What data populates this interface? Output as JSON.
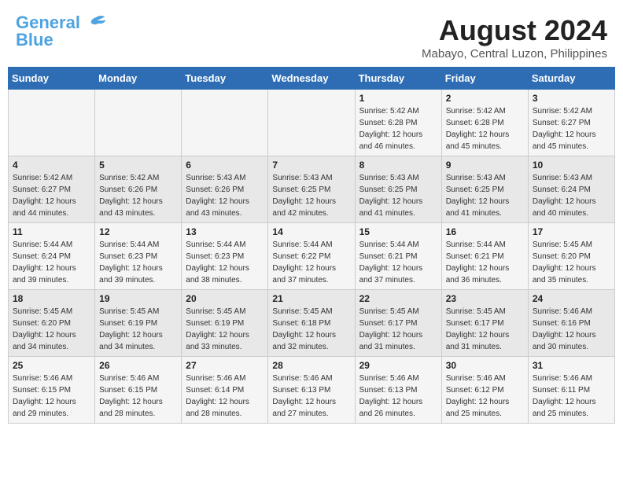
{
  "header": {
    "logo_line1": "General",
    "logo_line2": "Blue",
    "month_year": "August 2024",
    "location": "Mabayo, Central Luzon, Philippines"
  },
  "days_of_week": [
    "Sunday",
    "Monday",
    "Tuesday",
    "Wednesday",
    "Thursday",
    "Friday",
    "Saturday"
  ],
  "weeks": [
    [
      {
        "day": "",
        "info": ""
      },
      {
        "day": "",
        "info": ""
      },
      {
        "day": "",
        "info": ""
      },
      {
        "day": "",
        "info": ""
      },
      {
        "day": "1",
        "info": "Sunrise: 5:42 AM\nSunset: 6:28 PM\nDaylight: 12 hours\nand 46 minutes."
      },
      {
        "day": "2",
        "info": "Sunrise: 5:42 AM\nSunset: 6:28 PM\nDaylight: 12 hours\nand 45 minutes."
      },
      {
        "day": "3",
        "info": "Sunrise: 5:42 AM\nSunset: 6:27 PM\nDaylight: 12 hours\nand 45 minutes."
      }
    ],
    [
      {
        "day": "4",
        "info": "Sunrise: 5:42 AM\nSunset: 6:27 PM\nDaylight: 12 hours\nand 44 minutes."
      },
      {
        "day": "5",
        "info": "Sunrise: 5:42 AM\nSunset: 6:26 PM\nDaylight: 12 hours\nand 43 minutes."
      },
      {
        "day": "6",
        "info": "Sunrise: 5:43 AM\nSunset: 6:26 PM\nDaylight: 12 hours\nand 43 minutes."
      },
      {
        "day": "7",
        "info": "Sunrise: 5:43 AM\nSunset: 6:25 PM\nDaylight: 12 hours\nand 42 minutes."
      },
      {
        "day": "8",
        "info": "Sunrise: 5:43 AM\nSunset: 6:25 PM\nDaylight: 12 hours\nand 41 minutes."
      },
      {
        "day": "9",
        "info": "Sunrise: 5:43 AM\nSunset: 6:25 PM\nDaylight: 12 hours\nand 41 minutes."
      },
      {
        "day": "10",
        "info": "Sunrise: 5:43 AM\nSunset: 6:24 PM\nDaylight: 12 hours\nand 40 minutes."
      }
    ],
    [
      {
        "day": "11",
        "info": "Sunrise: 5:44 AM\nSunset: 6:24 PM\nDaylight: 12 hours\nand 39 minutes."
      },
      {
        "day": "12",
        "info": "Sunrise: 5:44 AM\nSunset: 6:23 PM\nDaylight: 12 hours\nand 39 minutes."
      },
      {
        "day": "13",
        "info": "Sunrise: 5:44 AM\nSunset: 6:23 PM\nDaylight: 12 hours\nand 38 minutes."
      },
      {
        "day": "14",
        "info": "Sunrise: 5:44 AM\nSunset: 6:22 PM\nDaylight: 12 hours\nand 37 minutes."
      },
      {
        "day": "15",
        "info": "Sunrise: 5:44 AM\nSunset: 6:21 PM\nDaylight: 12 hours\nand 37 minutes."
      },
      {
        "day": "16",
        "info": "Sunrise: 5:44 AM\nSunset: 6:21 PM\nDaylight: 12 hours\nand 36 minutes."
      },
      {
        "day": "17",
        "info": "Sunrise: 5:45 AM\nSunset: 6:20 PM\nDaylight: 12 hours\nand 35 minutes."
      }
    ],
    [
      {
        "day": "18",
        "info": "Sunrise: 5:45 AM\nSunset: 6:20 PM\nDaylight: 12 hours\nand 34 minutes."
      },
      {
        "day": "19",
        "info": "Sunrise: 5:45 AM\nSunset: 6:19 PM\nDaylight: 12 hours\nand 34 minutes."
      },
      {
        "day": "20",
        "info": "Sunrise: 5:45 AM\nSunset: 6:19 PM\nDaylight: 12 hours\nand 33 minutes."
      },
      {
        "day": "21",
        "info": "Sunrise: 5:45 AM\nSunset: 6:18 PM\nDaylight: 12 hours\nand 32 minutes."
      },
      {
        "day": "22",
        "info": "Sunrise: 5:45 AM\nSunset: 6:17 PM\nDaylight: 12 hours\nand 31 minutes."
      },
      {
        "day": "23",
        "info": "Sunrise: 5:45 AM\nSunset: 6:17 PM\nDaylight: 12 hours\nand 31 minutes."
      },
      {
        "day": "24",
        "info": "Sunrise: 5:46 AM\nSunset: 6:16 PM\nDaylight: 12 hours\nand 30 minutes."
      }
    ],
    [
      {
        "day": "25",
        "info": "Sunrise: 5:46 AM\nSunset: 6:15 PM\nDaylight: 12 hours\nand 29 minutes."
      },
      {
        "day": "26",
        "info": "Sunrise: 5:46 AM\nSunset: 6:15 PM\nDaylight: 12 hours\nand 28 minutes."
      },
      {
        "day": "27",
        "info": "Sunrise: 5:46 AM\nSunset: 6:14 PM\nDaylight: 12 hours\nand 28 minutes."
      },
      {
        "day": "28",
        "info": "Sunrise: 5:46 AM\nSunset: 6:13 PM\nDaylight: 12 hours\nand 27 minutes."
      },
      {
        "day": "29",
        "info": "Sunrise: 5:46 AM\nSunset: 6:13 PM\nDaylight: 12 hours\nand 26 minutes."
      },
      {
        "day": "30",
        "info": "Sunrise: 5:46 AM\nSunset: 6:12 PM\nDaylight: 12 hours\nand 25 minutes."
      },
      {
        "day": "31",
        "info": "Sunrise: 5:46 AM\nSunset: 6:11 PM\nDaylight: 12 hours\nand 25 minutes."
      }
    ]
  ]
}
